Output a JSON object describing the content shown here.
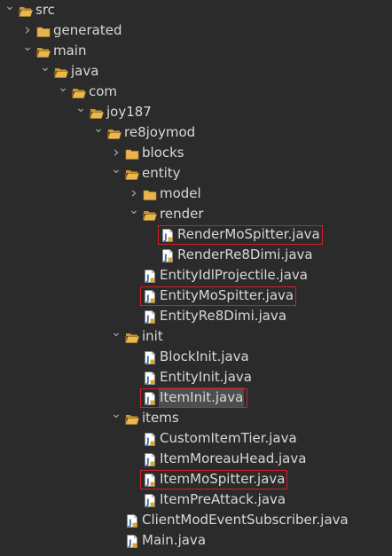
{
  "explorer": {
    "rows": [
      {
        "label": "src",
        "depth": 0,
        "kind": "folder",
        "expanded": true
      },
      {
        "label": "generated",
        "depth": 1,
        "kind": "folder",
        "expanded": false
      },
      {
        "label": "main",
        "depth": 1,
        "kind": "folder",
        "expanded": true
      },
      {
        "label": "java",
        "depth": 2,
        "kind": "folder",
        "expanded": true
      },
      {
        "label": "com",
        "depth": 3,
        "kind": "folder",
        "expanded": true
      },
      {
        "label": "joy187",
        "depth": 4,
        "kind": "folder",
        "expanded": true
      },
      {
        "label": "re8joymod",
        "depth": 5,
        "kind": "folder",
        "expanded": true
      },
      {
        "label": "blocks",
        "depth": 6,
        "kind": "folder",
        "expanded": false
      },
      {
        "label": "entity",
        "depth": 6,
        "kind": "folder",
        "expanded": true
      },
      {
        "label": "model",
        "depth": 7,
        "kind": "folder",
        "expanded": false
      },
      {
        "label": "render",
        "depth": 7,
        "kind": "folder",
        "expanded": true
      },
      {
        "label": "RenderMoSpitter.java",
        "depth": 8,
        "kind": "file",
        "highlighted": true
      },
      {
        "label": "RenderRe8Dimi.java",
        "depth": 8,
        "kind": "file"
      },
      {
        "label": "EntityIdlProjectile.java",
        "depth": 7,
        "kind": "file"
      },
      {
        "label": "EntityMoSpitter.java",
        "depth": 7,
        "kind": "file",
        "highlighted": true
      },
      {
        "label": "EntityRe8Dimi.java",
        "depth": 7,
        "kind": "file"
      },
      {
        "label": "init",
        "depth": 6,
        "kind": "folder",
        "expanded": true
      },
      {
        "label": "BlockInit.java",
        "depth": 7,
        "kind": "file"
      },
      {
        "label": "EntityInit.java",
        "depth": 7,
        "kind": "file"
      },
      {
        "label": "ItemInit.java",
        "depth": 7,
        "kind": "file",
        "highlighted": true,
        "selected": true
      },
      {
        "label": "items",
        "depth": 6,
        "kind": "folder",
        "expanded": true
      },
      {
        "label": "CustomItemTier.java",
        "depth": 7,
        "kind": "file"
      },
      {
        "label": "ItemMoreauHead.java",
        "depth": 7,
        "kind": "file"
      },
      {
        "label": "ItemMoSpitter.java",
        "depth": 7,
        "kind": "file",
        "highlighted": true
      },
      {
        "label": "ItemPreAttack.java",
        "depth": 7,
        "kind": "file"
      },
      {
        "label": "ClientModEventSubscriber.java",
        "depth": 6,
        "kind": "file"
      },
      {
        "label": "Main.java",
        "depth": 6,
        "kind": "file"
      }
    ]
  },
  "icons": {
    "expanded": "chevron-down-icon",
    "collapsed": "chevron-right-icon",
    "folder_open": "folder-open-icon",
    "folder_closed": "folder-icon",
    "java_file": "java-file-icon"
  },
  "colors": {
    "background": "#2b2b2b",
    "text": "#d8d8d8",
    "selection": "#4e4e4e",
    "highlight_box": "#d21f26",
    "folder": "#e8b34c",
    "java_file": "#5a87c7"
  }
}
